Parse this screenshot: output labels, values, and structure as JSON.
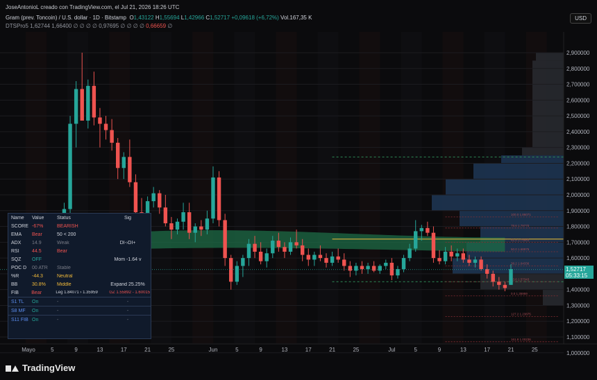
{
  "header": {
    "credit": "JoseAntonioL creado con TradingView.com, el Jul 21, 2026 18:26 UTC",
    "symbol": "Gram (prev. Toncoin) / U.S. dollar · 1D · Bitstamp",
    "o_label": "O",
    "o_value": "1,43122",
    "h_label": "H",
    "h_value": "1,55694",
    "l_label": "L",
    "l_value": "1,42966",
    "c_label": "C",
    "c_value": "1,52717",
    "change": "+0,09618 (+6,72%)",
    "vol": "Vol.167,35 K",
    "indicator": "DTSPro5",
    "ind_v1": "1,62744",
    "ind_v2": "1,66400",
    "ind_na": "∅ ∅ ∅ ∅",
    "ind_v3": "0,97695",
    "ind_na2": "∅ ∅ ∅ ∅",
    "ind_v4": "0,66659",
    "ind_na3": "∅",
    "currency": "USD"
  },
  "price_tag": {
    "price": "1,52717",
    "countdown": "05:33:15"
  },
  "footer": {
    "brand": "TradingView"
  },
  "colors": {
    "up": "#26a69a",
    "down": "#ef5350",
    "bg": "#0b0b0d",
    "ribbon": "#1e6b45",
    "gold": "#c8a63a",
    "zone": "#1f3a5a"
  },
  "chart_data": {
    "type": "candlestick",
    "y_ticks": [
      "2,900000",
      "2,800000",
      "2,700000",
      "2,600000",
      "2,500000",
      "2,400000",
      "2,300000",
      "2,200000",
      "2,100000",
      "2,000000",
      "1,900000",
      "1,800000",
      "1,700000",
      "1,600000",
      "1,500000",
      "1,400000",
      "1,300000",
      "1,200000",
      "1,100000",
      "1,000000"
    ],
    "ylim": [
      1.05,
      3.05
    ],
    "x_ticks": [
      {
        "label": "Mayo",
        "i": 0
      },
      {
        "label": "5",
        "i": 4
      },
      {
        "label": "9",
        "i": 8
      },
      {
        "label": "13",
        "i": 12
      },
      {
        "label": "17",
        "i": 16
      },
      {
        "label": "21",
        "i": 20
      },
      {
        "label": "25",
        "i": 24
      },
      {
        "label": "Jun",
        "i": 31
      },
      {
        "label": "5",
        "i": 35
      },
      {
        "label": "9",
        "i": 39
      },
      {
        "label": "13",
        "i": 43
      },
      {
        "label": "17",
        "i": 47
      },
      {
        "label": "21",
        "i": 51
      },
      {
        "label": "25",
        "i": 55
      },
      {
        "label": "Jul",
        "i": 61
      },
      {
        "label": "5",
        "i": 65
      },
      {
        "label": "9",
        "i": 69
      },
      {
        "label": "13",
        "i": 73
      },
      {
        "label": "17",
        "i": 77
      },
      {
        "label": "21",
        "i": 81
      },
      {
        "label": "25",
        "i": 85
      }
    ],
    "candles": [
      [
        1.3,
        1.32,
        1.28,
        1.31
      ],
      [
        1.31,
        1.33,
        1.29,
        1.3
      ],
      [
        1.3,
        1.34,
        1.29,
        1.33
      ],
      [
        1.33,
        1.35,
        1.31,
        1.32
      ],
      [
        1.32,
        1.42,
        1.3,
        1.4
      ],
      [
        1.4,
        1.68,
        1.38,
        1.63
      ],
      [
        1.63,
        1.95,
        1.6,
        1.91
      ],
      [
        1.91,
        2.5,
        1.86,
        2.45
      ],
      [
        2.45,
        2.72,
        2.3,
        2.67
      ],
      [
        2.67,
        2.9,
        2.55,
        2.47
      ],
      [
        2.47,
        2.73,
        2.42,
        2.69
      ],
      [
        2.69,
        2.78,
        2.44,
        2.49
      ],
      [
        2.49,
        2.55,
        2.3,
        2.45
      ],
      [
        2.45,
        2.5,
        2.35,
        2.41
      ],
      [
        2.41,
        2.48,
        2.28,
        2.33
      ],
      [
        2.33,
        2.36,
        2.1,
        2.17
      ],
      [
        2.17,
        2.27,
        2.1,
        2.24
      ],
      [
        2.24,
        2.35,
        2.05,
        2.08
      ],
      [
        2.08,
        2.13,
        1.85,
        1.89
      ],
      [
        1.89,
        1.98,
        1.82,
        1.86
      ],
      [
        1.86,
        1.99,
        1.83,
        1.96
      ],
      [
        1.96,
        2.05,
        1.92,
        2.01
      ],
      [
        2.01,
        2.03,
        1.88,
        1.92
      ],
      [
        1.92,
        2.0,
        1.8,
        1.82
      ],
      [
        1.82,
        1.86,
        1.72,
        1.78
      ],
      [
        1.78,
        1.85,
        1.75,
        1.83
      ],
      [
        1.83,
        1.95,
        1.78,
        1.89
      ],
      [
        1.89,
        1.95,
        1.72,
        1.76
      ],
      [
        1.76,
        1.82,
        1.7,
        1.8
      ],
      [
        1.8,
        1.84,
        1.74,
        1.78
      ],
      [
        1.78,
        1.9,
        1.75,
        1.85
      ],
      [
        1.85,
        2.18,
        1.82,
        2.11
      ],
      [
        2.11,
        2.15,
        1.8,
        1.84
      ],
      [
        1.84,
        1.88,
        1.55,
        1.6
      ],
      [
        1.6,
        1.62,
        1.4,
        1.45
      ],
      [
        1.45,
        1.58,
        1.43,
        1.55
      ],
      [
        1.55,
        1.62,
        1.48,
        1.6
      ],
      [
        1.6,
        1.72,
        1.55,
        1.69
      ],
      [
        1.69,
        1.74,
        1.6,
        1.64
      ],
      [
        1.64,
        1.7,
        1.56,
        1.58
      ],
      [
        1.58,
        1.66,
        1.54,
        1.63
      ],
      [
        1.63,
        1.74,
        1.6,
        1.71
      ],
      [
        1.71,
        1.76,
        1.64,
        1.67
      ],
      [
        1.67,
        1.7,
        1.6,
        1.64
      ],
      [
        1.64,
        1.73,
        1.62,
        1.7
      ],
      [
        1.7,
        1.78,
        1.66,
        1.68
      ],
      [
        1.68,
        1.72,
        1.58,
        1.62
      ],
      [
        1.62,
        1.66,
        1.55,
        1.59
      ],
      [
        1.59,
        1.64,
        1.55,
        1.62
      ],
      [
        1.62,
        1.68,
        1.58,
        1.6
      ],
      [
        1.6,
        1.63,
        1.54,
        1.57
      ],
      [
        1.57,
        1.64,
        1.55,
        1.61
      ],
      [
        1.61,
        1.66,
        1.57,
        1.59
      ],
      [
        1.59,
        1.63,
        1.52,
        1.55
      ],
      [
        1.55,
        1.58,
        1.48,
        1.52
      ],
      [
        1.52,
        1.57,
        1.49,
        1.55
      ],
      [
        1.55,
        1.58,
        1.5,
        1.53
      ],
      [
        1.53,
        1.57,
        1.5,
        1.55
      ],
      [
        1.55,
        1.58,
        1.51,
        1.52
      ],
      [
        1.52,
        1.56,
        1.5,
        1.55
      ],
      [
        1.55,
        1.59,
        1.53,
        1.57
      ],
      [
        1.57,
        1.6,
        1.46,
        1.49
      ],
      [
        1.49,
        1.55,
        1.47,
        1.53
      ],
      [
        1.53,
        1.62,
        1.51,
        1.6
      ],
      [
        1.6,
        1.69,
        1.58,
        1.66
      ],
      [
        1.66,
        1.84,
        1.64,
        1.77
      ],
      [
        1.77,
        1.81,
        1.71,
        1.79
      ],
      [
        1.79,
        1.83,
        1.74,
        1.76
      ],
      [
        1.76,
        1.8,
        1.57,
        1.6
      ],
      [
        1.6,
        1.65,
        1.56,
        1.58
      ],
      [
        1.58,
        1.67,
        1.56,
        1.64
      ],
      [
        1.64,
        1.68,
        1.58,
        1.61
      ],
      [
        1.61,
        1.66,
        1.58,
        1.63
      ],
      [
        1.63,
        1.66,
        1.57,
        1.59
      ],
      [
        1.59,
        1.62,
        1.55,
        1.57
      ],
      [
        1.57,
        1.61,
        1.54,
        1.59
      ],
      [
        1.59,
        1.61,
        1.52,
        1.53
      ],
      [
        1.53,
        1.56,
        1.47,
        1.5
      ],
      [
        1.5,
        1.52,
        1.42,
        1.45
      ],
      [
        1.45,
        1.48,
        1.4,
        1.43
      ],
      [
        1.43,
        1.45,
        1.39,
        1.41
      ],
      [
        1.43,
        1.56,
        1.43,
        1.53
      ]
    ],
    "levels": [
      {
        "label": "100.0  1.86071",
        "y": 1.86
      },
      {
        "label": "78.6  1.79770",
        "y": 1.79
      },
      {
        "label": "61.8  1.75883",
        "y": 1.7
      },
      {
        "label": "50.0  1.68975",
        "y": 1.64
      },
      {
        "label": "38.2  1.64336",
        "y": 1.55
      },
      {
        "label": "23.6  1.57343",
        "y": 1.45
      },
      {
        "label": "0.0  1.35959",
        "y": 1.36
      },
      {
        "label": "127.2  1.23875",
        "y": 1.23
      },
      {
        "label": "161.8  1.00236",
        "y": 1.07
      }
    ]
  },
  "panel": {
    "headers": [
      "Name",
      "Value",
      "Status",
      "Sig"
    ],
    "rows": [
      [
        "SCORE",
        "-67%",
        "BEARISH",
        ""
      ],
      [
        "EMA",
        "Bear",
        "50 < 200",
        ""
      ],
      [
        "ADX",
        "14.9",
        "Weak",
        "DI-›DI+"
      ],
      [
        "RSI",
        "44.5",
        "Bear",
        ""
      ],
      [
        "SQZ",
        "OFF",
        "",
        "Mom -1.64 v"
      ],
      [
        "POC D",
        "00 ATR",
        "Stable",
        ""
      ],
      [
        "%R",
        "-44.3",
        "Neutral",
        ""
      ],
      [
        "BB",
        "30.8%",
        "Middle",
        "Expand 25.25%"
      ],
      [
        "FIB",
        "Bear",
        "Leg 1.84071 › 1.35959",
        "GZ 1.55892 - 1.60015"
      ],
      [
        "S1 TL",
        "On",
        "-",
        "-"
      ],
      [
        "S8 MF",
        "On",
        "-",
        "-"
      ],
      [
        "S11 FIB",
        "On",
        "-",
        "-"
      ]
    ],
    "row_colors": [
      [
        "#d1d4dc",
        "#ef5350",
        "#ef5350",
        ""
      ],
      [
        "#d1d4dc",
        "#ef5350",
        "#d1d4dc",
        ""
      ],
      [
        "#d1d4dc",
        "#787b86",
        "#787b86",
        "#d1d4dc"
      ],
      [
        "#d1d4dc",
        "#ef5350",
        "#ef5350",
        ""
      ],
      [
        "#d1d4dc",
        "#26a69a",
        "",
        "#d1d4dc"
      ],
      [
        "#d1d4dc",
        "#787b86",
        "#787b86",
        ""
      ],
      [
        "#d1d4dc",
        "#f0b93a",
        "#f0b93a",
        ""
      ],
      [
        "#d1d4dc",
        "#f0b93a",
        "#f0b93a",
        "#d1d4dc"
      ],
      [
        "#d1d4dc",
        "#ef5350",
        "#d1d4dc",
        "#ef5350"
      ],
      [
        "#5b8def",
        "#26a69a",
        "#787b86",
        "#787b86"
      ],
      [
        "#5b8def",
        "#26a69a",
        "#787b86",
        "#787b86"
      ],
      [
        "#5b8def",
        "#26a69a",
        "#787b86",
        "#787b86"
      ]
    ]
  }
}
